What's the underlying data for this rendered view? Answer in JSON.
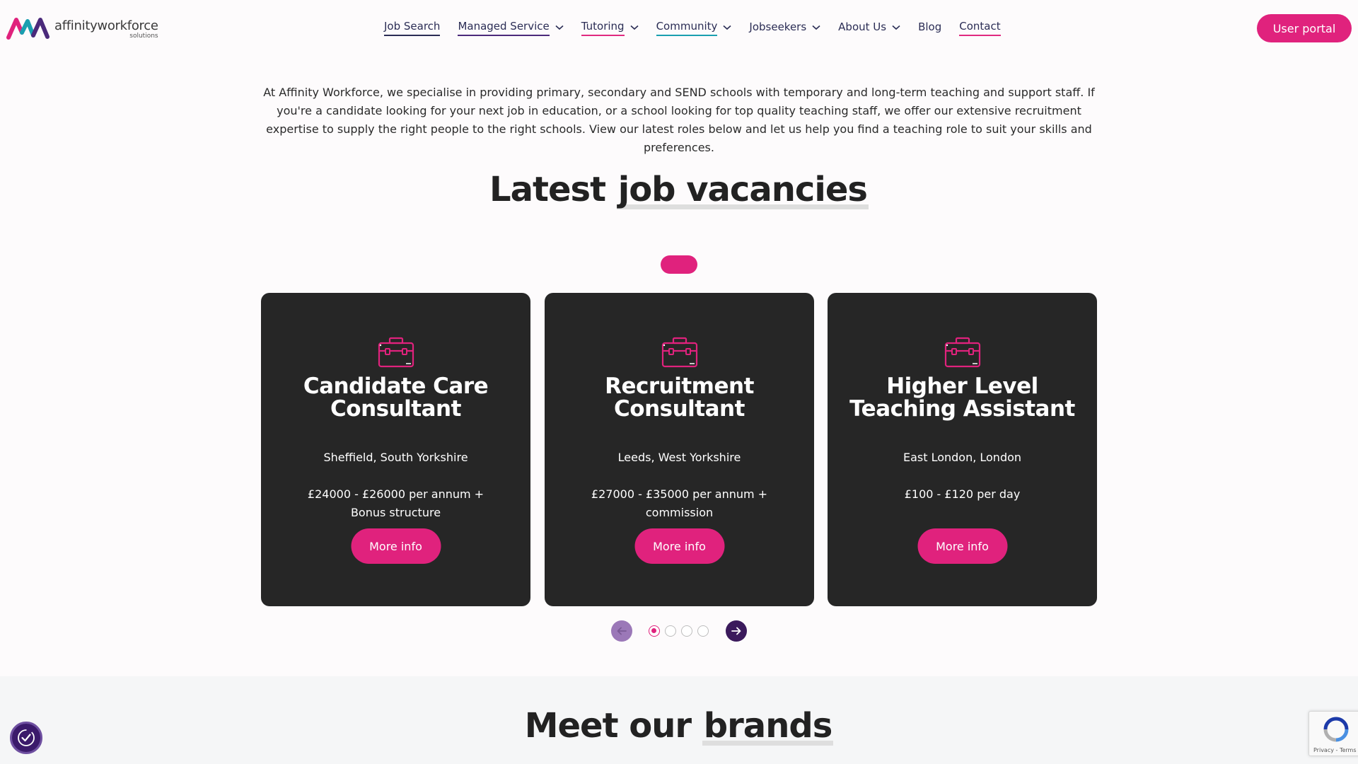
{
  "brand": {
    "logo_main": "affinityworkforce",
    "logo_sub": "solutions"
  },
  "nav": [
    {
      "label": "Job Search",
      "dropdown": false
    },
    {
      "label": "Managed Service",
      "dropdown": true
    },
    {
      "label": "Tutoring",
      "dropdown": true
    },
    {
      "label": "Community",
      "dropdown": true
    },
    {
      "label": "Jobseekers",
      "dropdown": true
    },
    {
      "label": "About Us",
      "dropdown": true
    },
    {
      "label": "Blog",
      "dropdown": false
    },
    {
      "label": "Contact",
      "dropdown": false
    }
  ],
  "header": {
    "portal_label": "User portal"
  },
  "intro": {
    "text": "At Affinity Workforce, we specialise in providing primary, secondary and SEND schools with temporary and long-term teaching and support staff. If you're a candidate looking for your next job in education, or a school looking for top quality teaching staff, we offer our extensive recruitment expertise to supply the right people to the right schools. View our latest roles below and let us help you find a teaching role to suit your skills and preferences."
  },
  "vacancies": {
    "title_plain": "Latest ",
    "title_highlight": "job vacancies",
    "cards": [
      {
        "title": "Candidate Care Consultant",
        "location": "Sheffield, South Yorkshire",
        "pay": "£24000 - £26000 per annum + Bonus structure",
        "button": "More info"
      },
      {
        "title": "Recruitment Consultant",
        "location": "Leeds, West Yorkshire",
        "pay": "£27000 - £35000 per annum + commission",
        "button": "More info"
      },
      {
        "title": "Higher Level Teaching Assistant",
        "location": "East London, London",
        "pay": "£100 - £120 per day",
        "button": "More info"
      }
    ],
    "pagination": {
      "pages": 4,
      "current": 1
    }
  },
  "brands": {
    "title_plain": "Meet our ",
    "title_highlight": "brands"
  },
  "recaptcha": {
    "text": "Privacy - Terms"
  },
  "colors": {
    "accent": "#e0227d",
    "navy": "#2b2d55",
    "purple": "#3b1a5c",
    "card_bg": "#262626"
  }
}
